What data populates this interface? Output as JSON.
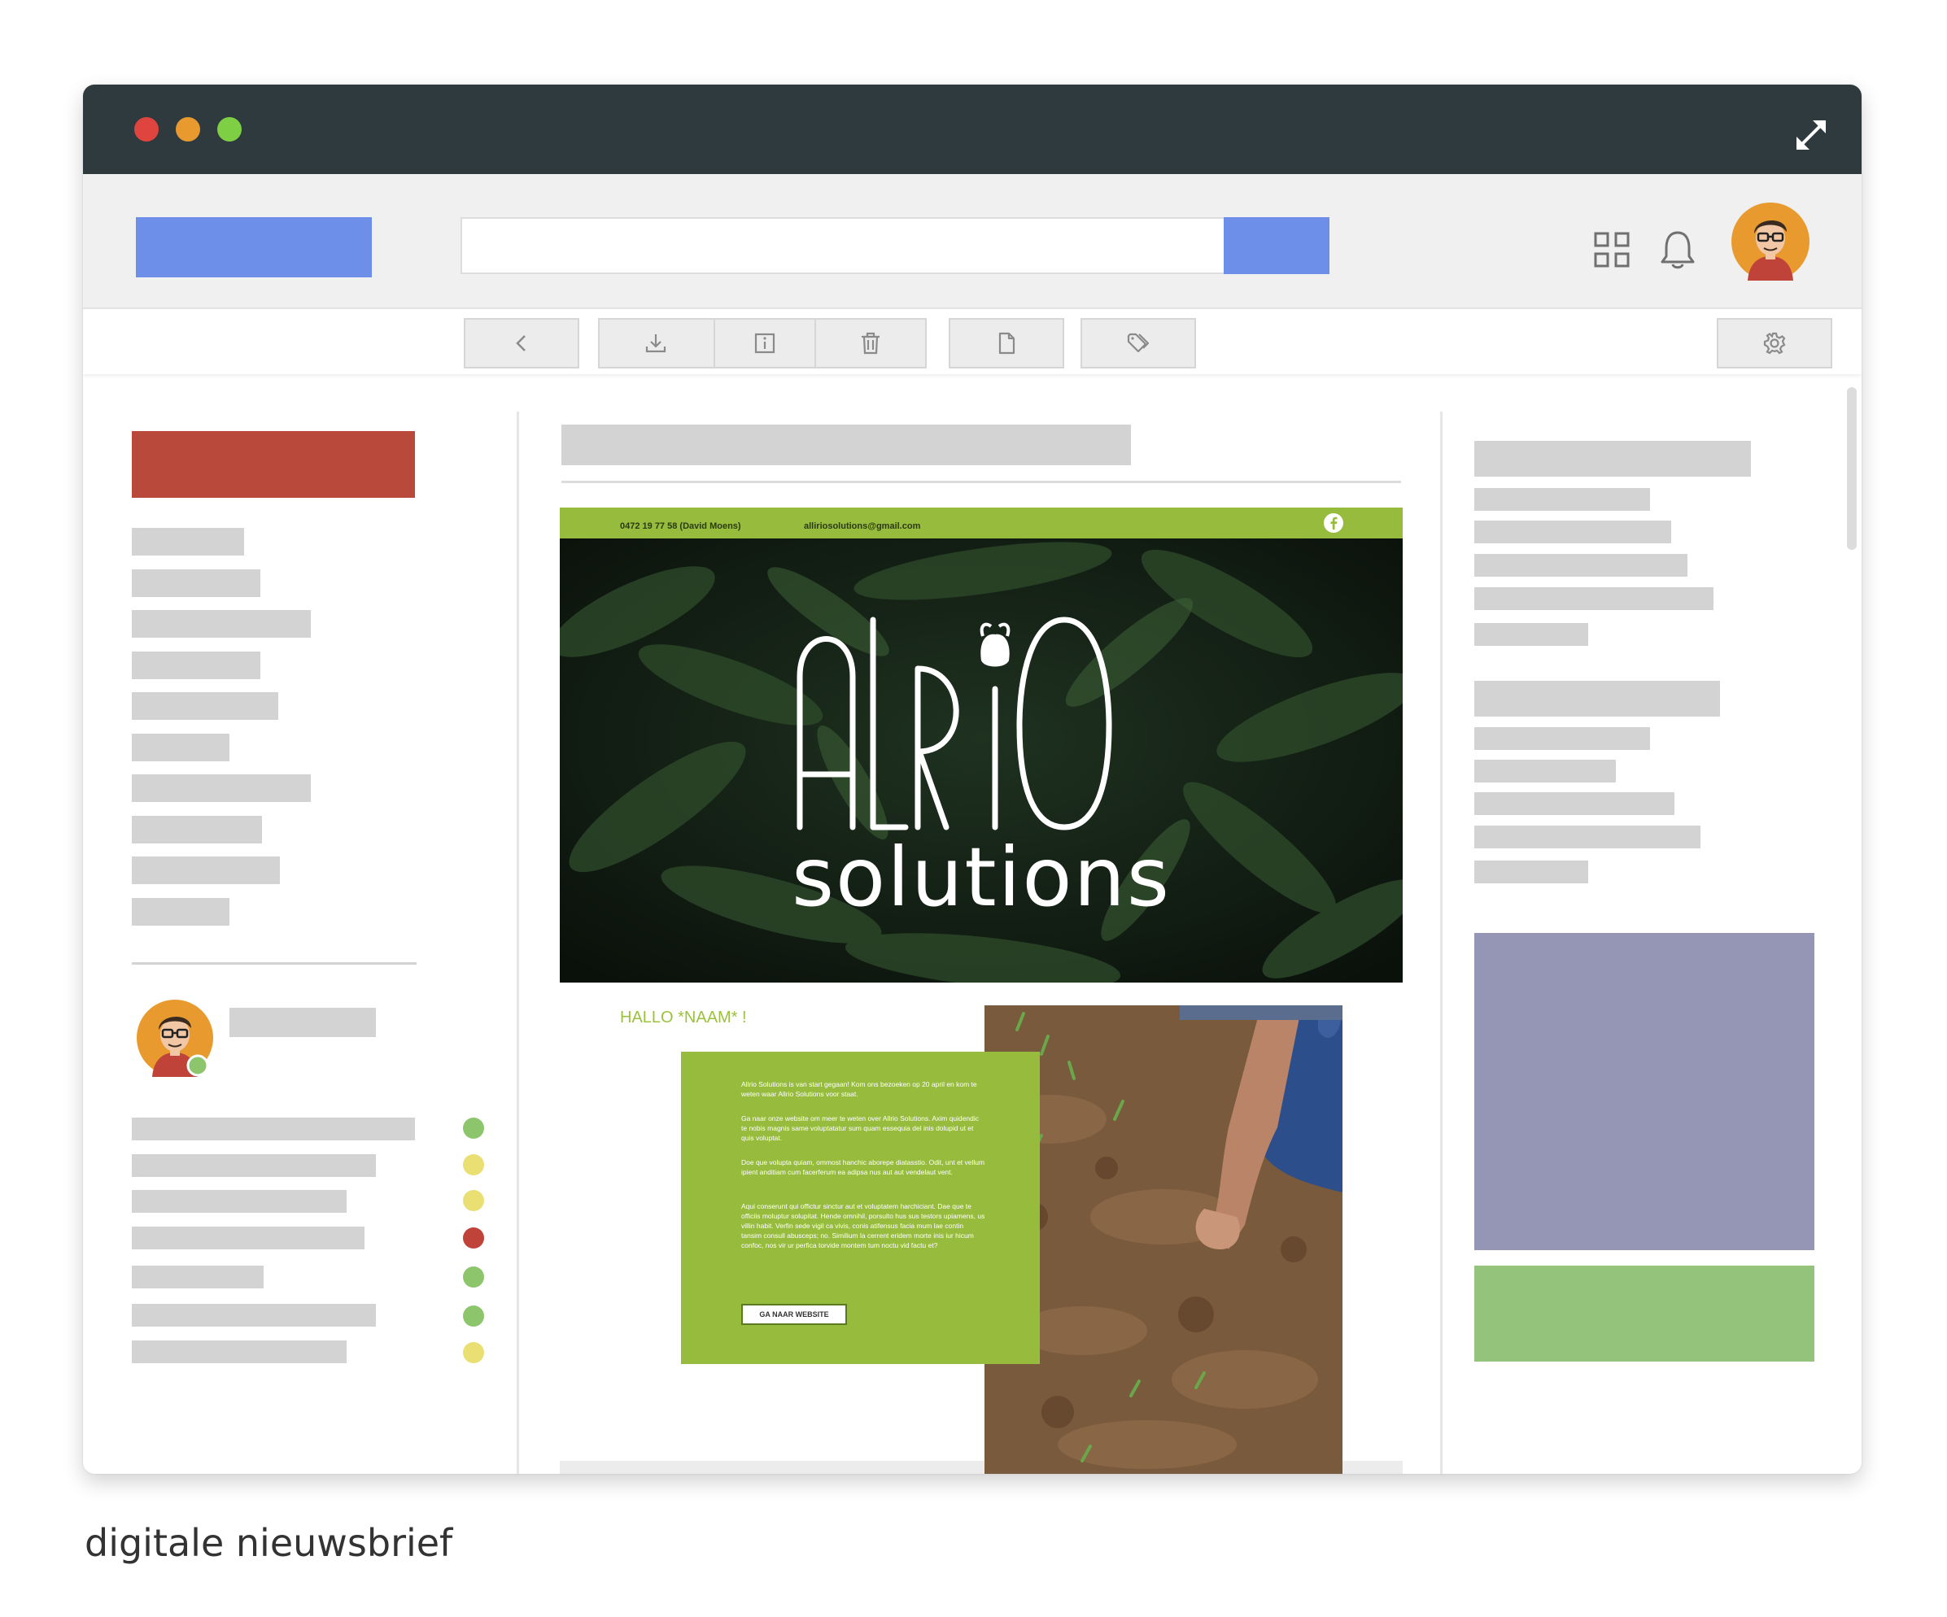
{
  "newsletter": {
    "phone": "0472 19 77 58 (David Moens)",
    "email": "alliriosolutions@gmail.com",
    "logo_main": "ALLRIO",
    "logo_sub": "solutions",
    "greeting": "HALLO *NAAM* !",
    "paragraphs": [
      "Allrio Solutions is van start gegaan! Kom ons bezoeken op 20 april en kom te weten waar Allrio Solutions voor staat.",
      "Ga naar onze website om meer te weten over Allrio Solutions. Axim quidendic te nobis magnis same voluptatatur sum quam essequia del inis dolupid ut et quis voluptat.",
      "Doe que volupta quiam, ommost hanchic aborepe diatasstio. Odit, unt et vellum ipient anditiam cum facerferum ea adipsa nus aut aut vendelaut vent.",
      "Aqui conserunt qui offictur sinctur aut et voluptatem harchiciant. Dae que te officiis moluptur solupitat. Hende omnihil, porsulto hus sus testors upiamens, us villin habit. Verfin sede vigil ca vivis, conis atifensus facia mum lae contin tansim consull abusceps; no. Similium la cerrent eridem morte inis iur hicum confoc, nos vir ur perfica torvide montem tum noctu vid factu et?"
    ],
    "button_label": "GA NAAR WEBSITE"
  },
  "caption": "digitale nieuwsbrief",
  "icons": {
    "window_controls": [
      "close-icon",
      "minimize-icon",
      "maximize-icon"
    ],
    "expand": "expand-icon",
    "apps": "grid-icon",
    "notifications": "bell-icon",
    "toolbar": [
      "back-icon",
      "download-icon",
      "info-icon",
      "trash-icon",
      "document-icon",
      "tag-icon",
      "gear-icon"
    ],
    "social": "facebook-icon"
  },
  "colors": {
    "titlebar": "#2e3a3d",
    "accent_blue": "#6e8fe9",
    "compose_red": "#b94a3b",
    "newsletter_green": "#96bb3d",
    "panel_purple": "#9595b5",
    "panel_green": "#94c47b",
    "status_green": "#8dc56d",
    "status_yellow": "#eadf73",
    "status_red": "#c0433a"
  },
  "status_dots": [
    "green",
    "yellow",
    "yellow",
    "red",
    "green",
    "green",
    "yellow"
  ]
}
